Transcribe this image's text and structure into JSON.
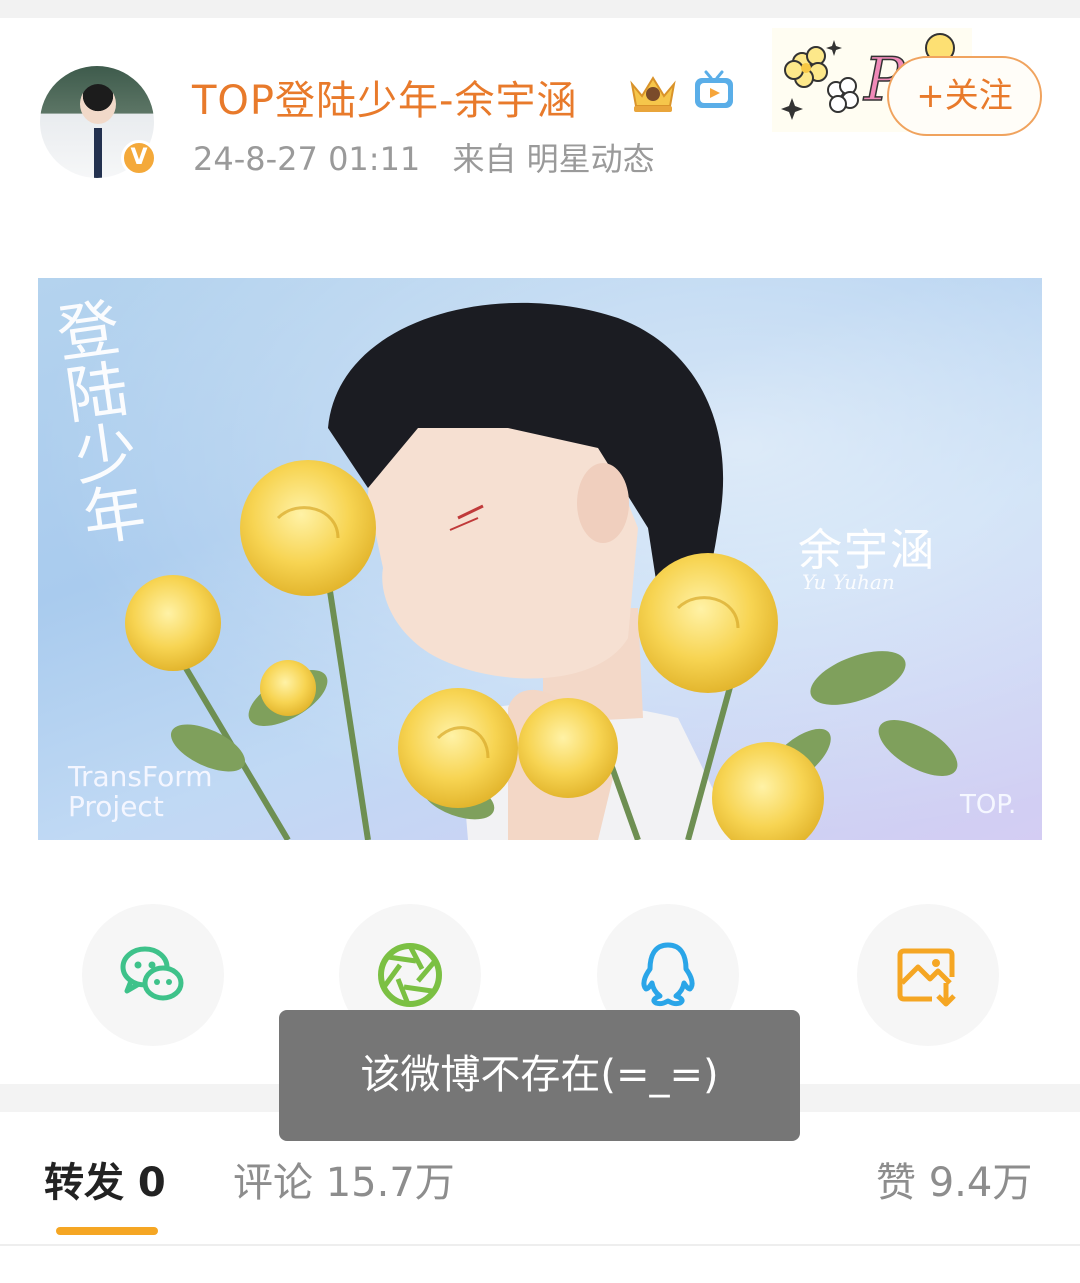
{
  "header": {
    "username": "TOP登陆少年-余宇涵",
    "timestamp": "24-8-27 01:11",
    "source": "来自 明星动态",
    "follow_label": "+关注",
    "verified_badge": "V",
    "icons": [
      "avatar",
      "verified-badge-icon",
      "crown-icon",
      "tv-icon",
      "sticker-decoration"
    ]
  },
  "post_image": {
    "title_calligraphy": "登陆少年",
    "name": "余宇涵",
    "romanized_signature": "Yu Yuhan",
    "project_text": "TransForm\nProject",
    "brand": "TOP."
  },
  "share": {
    "items": [
      {
        "name": "wechat",
        "icon": "wechat-icon",
        "color": "#3ec28a"
      },
      {
        "name": "moments",
        "icon": "moments-aperture-icon",
        "color": "#7bc043"
      },
      {
        "name": "qq",
        "icon": "qq-penguin-icon",
        "color": "#2aa5e8"
      },
      {
        "name": "save-image",
        "icon": "save-image-icon",
        "color": "#f5a623"
      }
    ]
  },
  "toast": {
    "message": "该微博不存在(=_=)"
  },
  "tabs": {
    "repost": "转发 0",
    "comment": "评论 15.7万",
    "like": "赞 9.4万",
    "active": "repost",
    "accent": "#f5a623"
  },
  "colors": {
    "username": "#e87a2b",
    "meta": "#9a9a9a",
    "toast_bg": "#6c6c6c"
  }
}
